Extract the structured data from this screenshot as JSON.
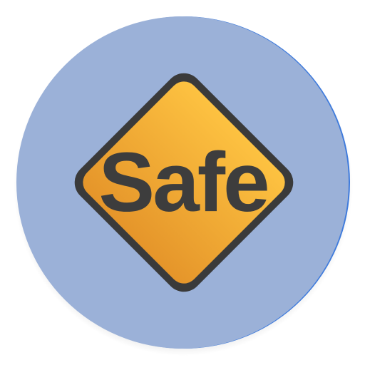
{
  "app_icon": {
    "name": "safe-app-icon",
    "sign_text": "Safe",
    "colors": {
      "background_circle": "#9bb1d8",
      "circle_edge_accent": "#3f7bdc",
      "sign_fill_top": "#fdc241",
      "sign_fill_bottom": "#e5952a",
      "sign_border": "#3a3a3a",
      "text": "#3d3d3d"
    },
    "icon_names": [
      "diamond-warning-sign-icon"
    ]
  }
}
